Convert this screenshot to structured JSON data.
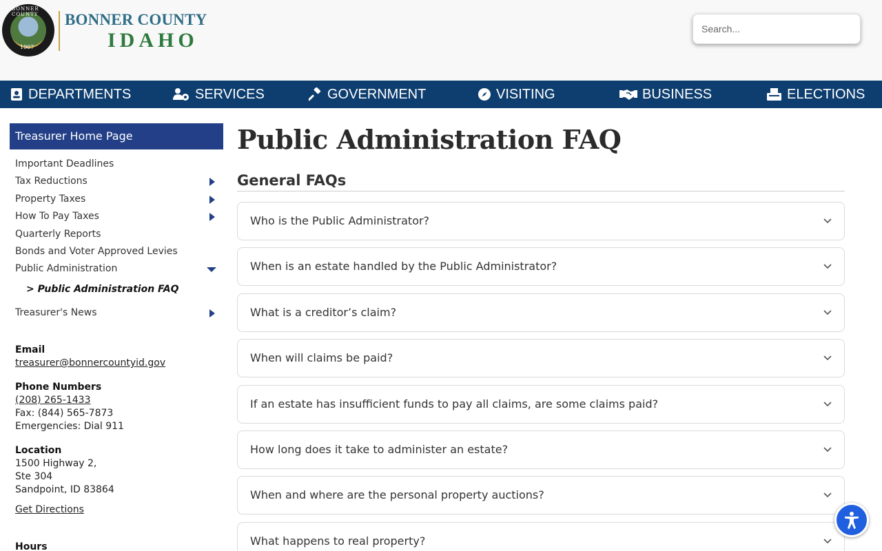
{
  "header": {
    "seal_text": "BONNER COUNTY",
    "seal_year": "1907",
    "county": "BONNER COUNTY",
    "state": "IDAHO",
    "search_placeholder": "Search..."
  },
  "nav": [
    {
      "label": "DEPARTMENTS",
      "icon": "id-card-icon"
    },
    {
      "label": "SERVICES",
      "icon": "users-gear-icon"
    },
    {
      "label": "GOVERNMENT",
      "icon": "gavel-icon"
    },
    {
      "label": "VISITING",
      "icon": "compass-icon"
    },
    {
      "label": "BUSINESS",
      "icon": "handshake-icon"
    },
    {
      "label": "ELECTIONS",
      "icon": "ballot-box-icon"
    }
  ],
  "sidebar": {
    "title": "Treasurer Home Page",
    "items": [
      {
        "label": "Important Deadlines"
      },
      {
        "label": "Tax Reductions"
      },
      {
        "label": "Property Taxes"
      },
      {
        "label": "How To Pay Taxes"
      },
      {
        "label": "Quarterly Reports"
      },
      {
        "label": "Bonds and Voter Approved Levies"
      },
      {
        "label": "Public Administration"
      },
      {
        "label": "Treasurer's News"
      }
    ],
    "active_sub": "> Public Administration FAQ",
    "email_heading": "Email",
    "email": "treasurer@bonnercountyid.gov",
    "phone_heading": "Phone Numbers",
    "phone": "(208) 265-1433",
    "fax": "Fax: (844) 565-7873",
    "emergency": "Emergencies: Dial 911",
    "location_heading": "Location",
    "address1": "1500 Highway 2,",
    "address2": "Ste 304",
    "address3": "Sandpoint, ID 83864",
    "directions": "Get Directions",
    "hours_heading": "Hours"
  },
  "main": {
    "title": "Public Administration FAQ",
    "section": "General FAQs",
    "faqs": [
      "Who is the Public Administrator?",
      "When is an estate handled by the Public Administrator?",
      "What is a creditor’s claim?",
      "When will claims be paid?",
      "If an estate has insufficient funds to pay all claims, are some claims paid?",
      "How long does it take to administer an estate?",
      "When and where are the personal property auctions?",
      "What happens to real property?"
    ]
  },
  "colors": {
    "nav_bg": "#0e3e6f",
    "sidebar_title_bg": "#223f87",
    "accessibility_button": "#1f5fe0"
  }
}
